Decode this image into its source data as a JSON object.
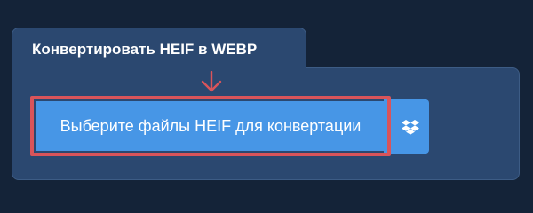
{
  "converter": {
    "tab_title": "Конвертировать HEIF в WEBP",
    "select_button_label": "Выберите файлы HEIF для конвертации",
    "cloud_button_icon": "dropbox-icon",
    "pointer_icon": "arrow-down-icon"
  },
  "colors": {
    "page_background": "#142338",
    "panel_background": "#2b4870",
    "button_blue": "#4796e6",
    "highlight_red": "#d9545a",
    "text_white": "#ffffff"
  }
}
